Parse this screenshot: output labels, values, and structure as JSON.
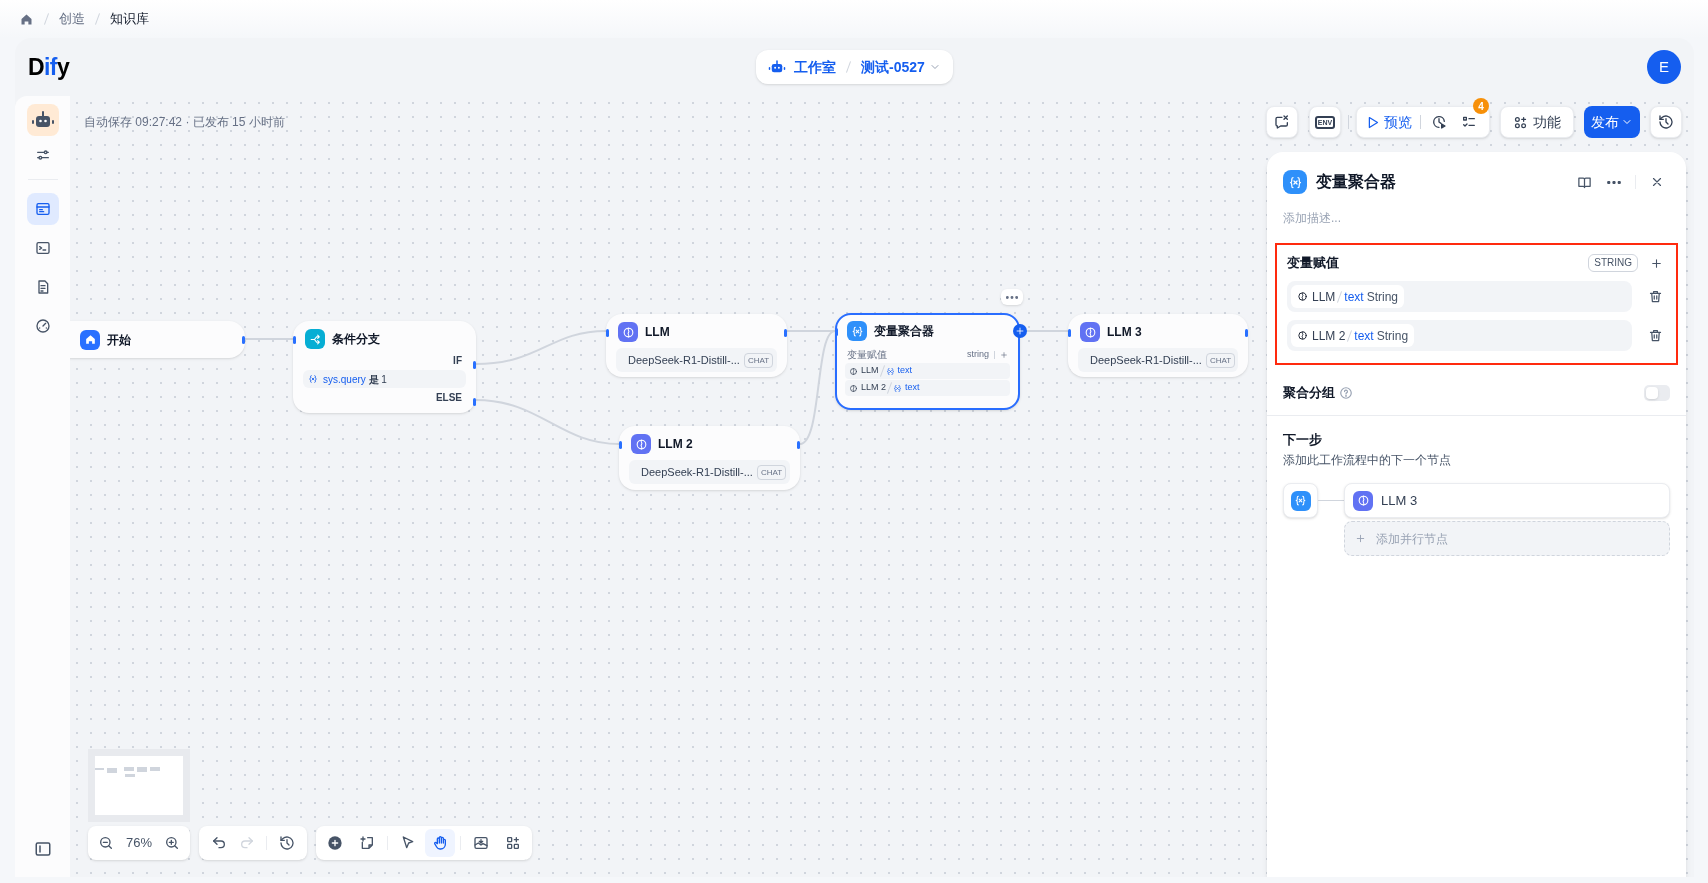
{
  "breadcrumb": [
    {
      "label": "创造",
      "current": false
    },
    {
      "label": "知识库",
      "current": true
    }
  ],
  "header": {
    "logo": [
      {
        "text": "D",
        "accent": false
      },
      {
        "text": "if",
        "accent": true
      },
      {
        "text": "y",
        "accent": false
      }
    ],
    "workspace": "工作室",
    "app_name": "测试-0527",
    "avatar": "E"
  },
  "sidebar": {
    "items": [
      {
        "kind": "settings",
        "selected": false
      },
      {
        "kind": "workflow",
        "selected": true
      },
      {
        "kind": "logs",
        "selected": false
      },
      {
        "kind": "annotations",
        "selected": false
      },
      {
        "kind": "monitoring",
        "selected": false
      }
    ]
  },
  "canvas": {
    "status": "自动保存 09:27:42 · 已发布 15 小时前",
    "toolbar": {
      "env": "ENV",
      "preview": "预览",
      "checklist_count": "4",
      "features": "功能",
      "publish": "发布"
    },
    "nodes": [
      {
        "kind": "start",
        "title": "开始",
        "selected": false
      },
      {
        "kind": "if-else",
        "title": "条件分支",
        "selected": false,
        "if_label": "IF",
        "else_label": "ELSE",
        "condition": {
          "variable": "sys.query",
          "operator": "是",
          "value": "1"
        }
      },
      {
        "kind": "llm",
        "title": "LLM",
        "selected": false,
        "model": "DeepSeek-R1-Distill-...",
        "mode": "CHAT"
      },
      {
        "kind": "llm",
        "title": "LLM 2",
        "selected": false,
        "model": "DeepSeek-R1-Distill-...",
        "mode": "CHAT"
      },
      {
        "kind": "aggregator",
        "title": "变量聚合器",
        "selected": true,
        "section": "变量赋值",
        "output_type": "string",
        "variables": [
          {
            "node": "LLM",
            "variable": "text"
          },
          {
            "node": "LLM 2",
            "variable": "text"
          }
        ]
      },
      {
        "kind": "llm",
        "title": "LLM 3",
        "selected": false,
        "model": "DeepSeek-R1-Distill-...",
        "mode": "CHAT"
      }
    ],
    "zoom": "76%",
    "undo_disabled": false,
    "redo_disabled": true,
    "tools": [
      {
        "kind": "add-node",
        "selected": false
      },
      {
        "kind": "add-note",
        "selected": false
      },
      {
        "kind": "pointer",
        "selected": false
      },
      {
        "kind": "hand",
        "selected": true
      },
      {
        "kind": "export",
        "selected": false
      },
      {
        "kind": "organize",
        "selected": false
      }
    ]
  },
  "panel": {
    "title": "变量聚合器",
    "description": {
      "placeholder": "添加描述..."
    },
    "highlighted": true,
    "variables_title": "变量赋值",
    "output_type": "STRING",
    "variables": [
      {
        "node": "LLM",
        "variable": "text",
        "type": "String"
      },
      {
        "node": "LLM 2",
        "variable": "text",
        "type": "String"
      }
    ],
    "group": {
      "label": "聚合分组",
      "on": false
    },
    "next_step": {
      "title": "下一步",
      "description": "添加此工作流程中的下一个节点",
      "nodes": [
        {
          "title": "LLM 3"
        }
      ],
      "add_parallel": "添加并行节点"
    }
  }
}
